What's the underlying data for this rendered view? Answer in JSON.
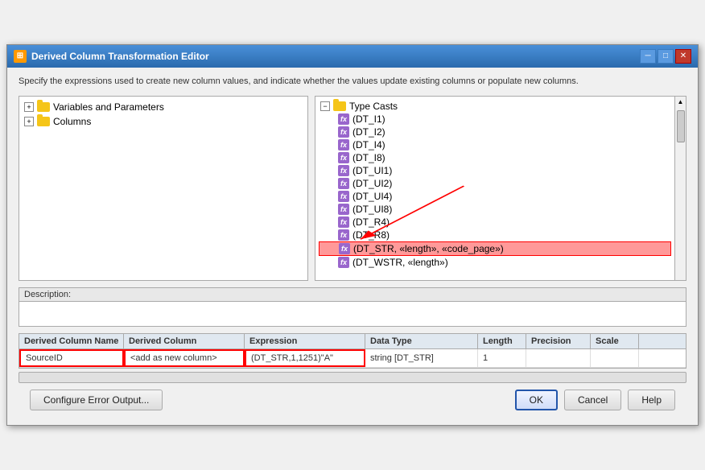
{
  "window": {
    "title": "Derived Column Transformation Editor",
    "description": "Specify the expressions used to create new column values, and indicate whether the values update existing columns or populate new columns."
  },
  "left_panel": {
    "items": [
      {
        "id": "variables",
        "label": "Variables and Parameters",
        "type": "folder",
        "expandable": true
      },
      {
        "id": "columns",
        "label": "Columns",
        "type": "folder",
        "expandable": true
      }
    ]
  },
  "right_panel": {
    "header": "Type Casts",
    "items": [
      {
        "label": "(DT_I1)",
        "type": "fx"
      },
      {
        "label": "(DT_I2)",
        "type": "fx"
      },
      {
        "label": "(DT_I4)",
        "type": "fx"
      },
      {
        "label": "(DT_I8)",
        "type": "fx"
      },
      {
        "label": "(DT_UI1)",
        "type": "fx"
      },
      {
        "label": "(DT_UI2)",
        "type": "fx"
      },
      {
        "label": "(DT_UI4)",
        "type": "fx"
      },
      {
        "label": "(DT_UI8)",
        "type": "fx"
      },
      {
        "label": "(DT_R4)",
        "type": "fx"
      },
      {
        "label": "(DT_R8)",
        "type": "fx"
      },
      {
        "label": "(DT_STR, «length», «code_page»)",
        "type": "fx",
        "highlighted": true
      },
      {
        "label": "(DT_WSTR, «length»)",
        "type": "fx"
      }
    ]
  },
  "description_label": "Description:",
  "grid": {
    "columns": [
      "Derived Column Name",
      "Derived Column",
      "Expression",
      "Data Type",
      "Length",
      "Precision",
      "Scale"
    ],
    "rows": [
      {
        "derived_column_name": "SourceID",
        "derived_column": "<add as new column>",
        "expression": "(DT_STR,1,1251)\"A\"",
        "data_type": "string [DT_STR]",
        "length": "1",
        "precision": "",
        "scale": ""
      }
    ]
  },
  "buttons": {
    "configure_error": "Configure Error Output...",
    "ok": "OK",
    "cancel": "Cancel",
    "help": "Help"
  },
  "title_controls": {
    "minimize": "─",
    "maximize": "□",
    "close": "✕"
  }
}
